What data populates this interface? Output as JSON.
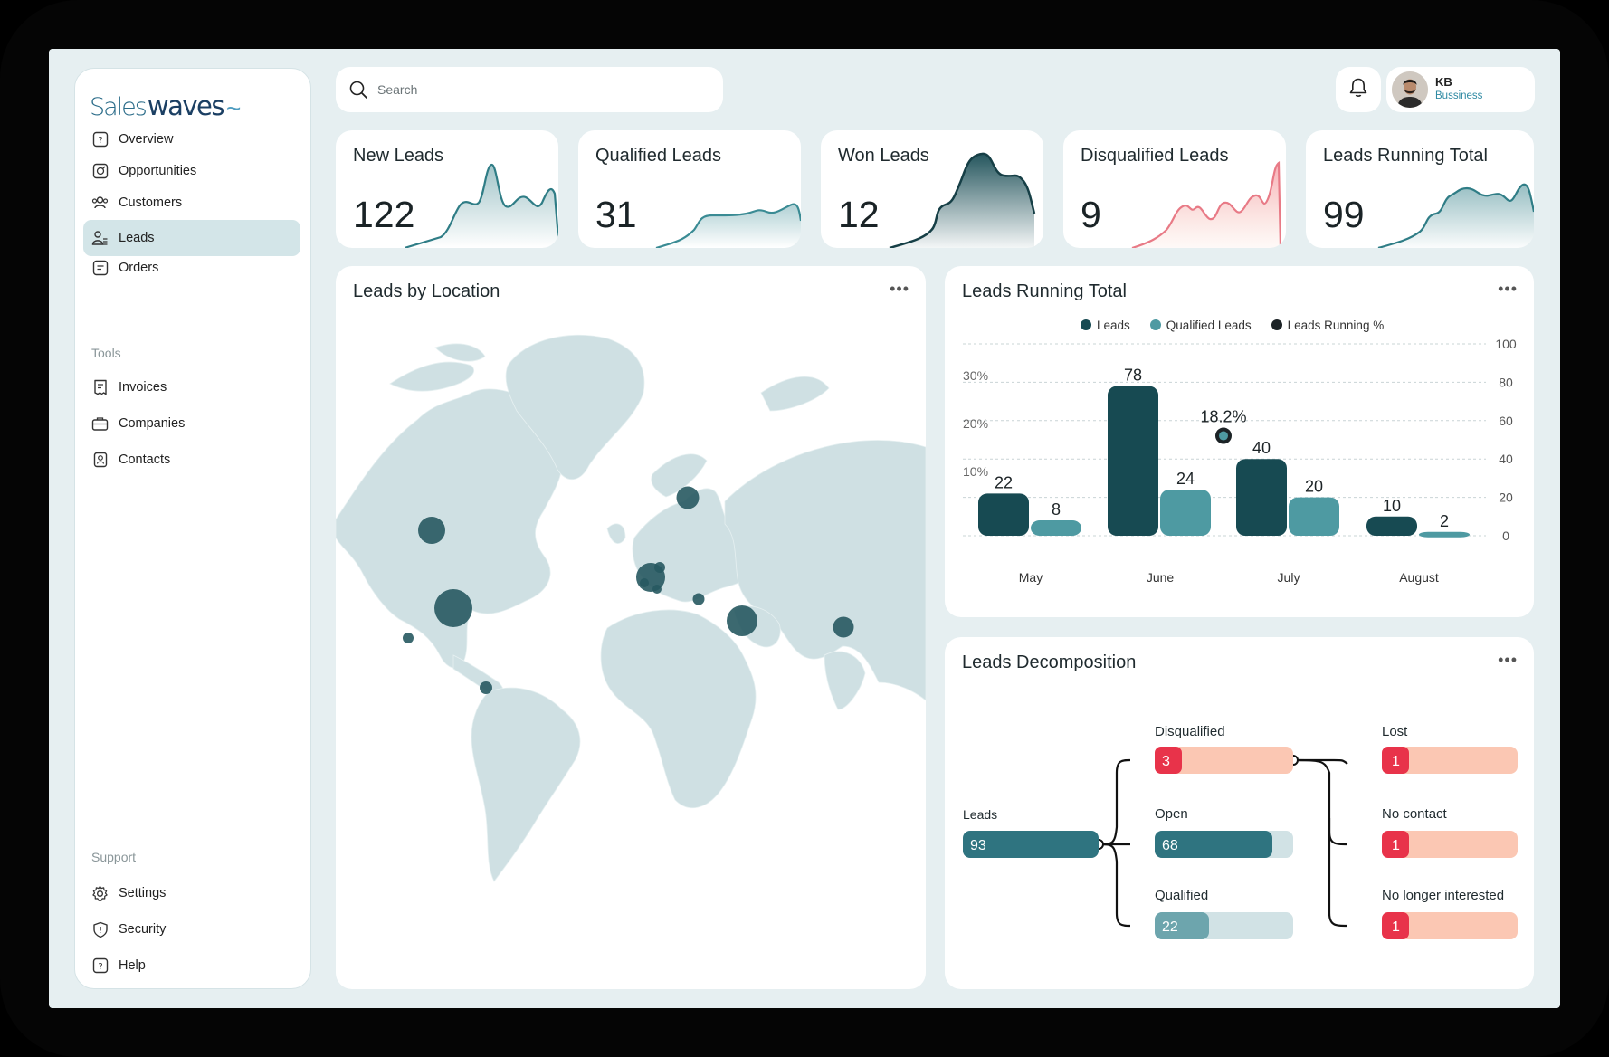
{
  "brand": {
    "part1": "Sales",
    "part2": "waves",
    "wave": "~"
  },
  "nav": {
    "main": [
      {
        "label": "Overview",
        "icon": "help-icon"
      },
      {
        "label": "Opportunities",
        "icon": "opportunities-icon"
      },
      {
        "label": "Customers",
        "icon": "users-icon"
      },
      {
        "label": "Leads",
        "icon": "leads-icon",
        "active": true
      },
      {
        "label": "Orders",
        "icon": "orders-icon"
      }
    ],
    "tools_heading": "Tools",
    "tools": [
      {
        "label": "Invoices",
        "icon": "invoice-icon"
      },
      {
        "label": "Companies",
        "icon": "briefcase-icon"
      },
      {
        "label": "Contacts",
        "icon": "contacts-icon"
      }
    ],
    "support_heading": "Support",
    "support": [
      {
        "label": "Settings",
        "icon": "gear-icon"
      },
      {
        "label": "Security",
        "icon": "shield-icon"
      },
      {
        "label": "Help",
        "icon": "help-icon"
      }
    ]
  },
  "search": {
    "placeholder": "Search"
  },
  "user": {
    "initials": "KB",
    "role": "Bussiness"
  },
  "kpis": [
    {
      "title": "New Leads",
      "value": "122",
      "color": "#2f7d86"
    },
    {
      "title": "Qualified Leads",
      "value": "31",
      "color": "#3a8b94"
    },
    {
      "title": "Won Leads",
      "value": "12",
      "color": "#1a4d55"
    },
    {
      "title": "Disqualified Leads",
      "value": "9",
      "color": "#e87a86"
    },
    {
      "title": "Leads Running Total",
      "value": "99",
      "color": "#2f7d86"
    }
  ],
  "map_card": {
    "title": "Leads by Location",
    "menu": "•••"
  },
  "running_card": {
    "title": "Leads Running Total",
    "menu": "•••",
    "legend": [
      {
        "label": "Leads",
        "color": "#174a52"
      },
      {
        "label": "Qualified Leads",
        "color": "#4e9aa2"
      },
      {
        "label": "Leads Running %",
        "color": "#1c2326"
      }
    ]
  },
  "chart_data": {
    "type": "bar",
    "categories": [
      "May",
      "June",
      "July",
      "August"
    ],
    "series": [
      {
        "name": "Leads",
        "values": [
          22,
          78,
          40,
          10
        ]
      },
      {
        "name": "Qualified Leads",
        "values": [
          8,
          24,
          20,
          2
        ]
      }
    ],
    "annotation": {
      "label": "18.2%",
      "category": "June",
      "value": 18.2
    },
    "y_right_ticks": [
      "100",
      "80",
      "60",
      "40",
      "20",
      "0"
    ],
    "y_left_ticks": [
      "30%",
      "20%",
      "10%"
    ],
    "ylim": [
      0,
      100
    ],
    "legend_position": "top-center",
    "grid": true
  },
  "decomp_card": {
    "title": "Leads Decomposition",
    "menu": "•••",
    "root": {
      "label": "Leads",
      "value": "93"
    },
    "middle": [
      {
        "label": "Disqualified",
        "value": "3"
      },
      {
        "label": "Open",
        "value": "68"
      },
      {
        "label": "Qualified",
        "value": "22"
      }
    ],
    "right": [
      {
        "label": "Lost",
        "value": "1"
      },
      {
        "label": "No contact",
        "value": "1"
      },
      {
        "label": "No longer interested",
        "value": "1"
      }
    ]
  }
}
